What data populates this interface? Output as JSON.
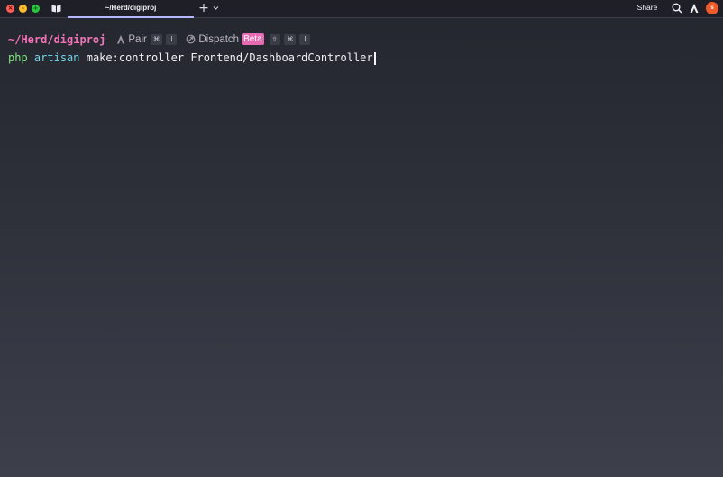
{
  "titlebar": {
    "tab_title": "~/Herd/digiproj",
    "new_tab_symbol": "+",
    "share_label": "Share",
    "avatar_initial": "s"
  },
  "prompt": {
    "cwd": "~/Herd/digiproj",
    "pair_label": "Pair",
    "pair_keys": [
      "⌘",
      "I"
    ],
    "dispatch_label": "Dispatch",
    "dispatch_badge": "Beta",
    "dispatch_keys": [
      "⇧",
      "⌘",
      "I"
    ]
  },
  "command": {
    "program": "php",
    "subcommand": "artisan",
    "arguments": "make:controller Frontend/DashboardController"
  },
  "colors": {
    "cwd": "#f272b8",
    "program": "#7ee87e",
    "subcommand": "#74d3ea",
    "beta_badge": "#e86ab3",
    "avatar": "#ee5a2a",
    "active_tab_underline": "#b6b8ff"
  },
  "icons": {
    "close": "close-window-icon",
    "minimize": "minimize-window-icon",
    "maximize": "maximize-window-icon",
    "workflows": "book-icon",
    "dropdown": "chevron-down-icon",
    "search": "search-icon",
    "agent": "agent-icon",
    "pair": "agent-icon",
    "dispatch": "dispatch-icon"
  }
}
